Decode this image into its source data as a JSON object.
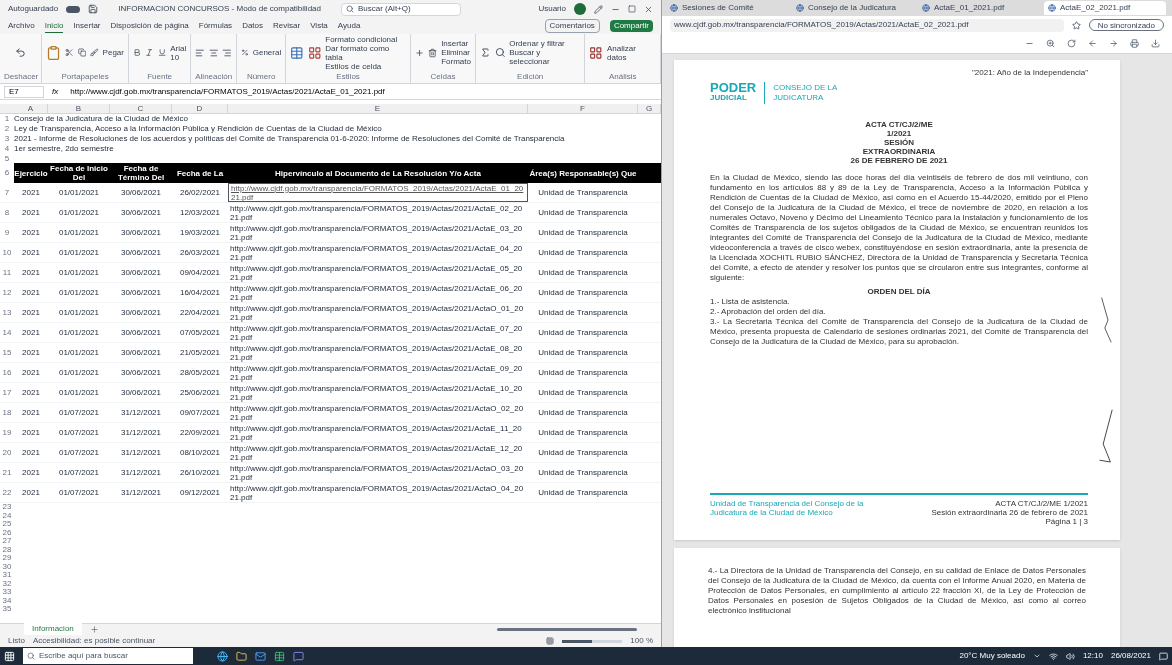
{
  "excel": {
    "autosave": "Autoguardado",
    "filename": "INFORMACION CONCURSOS - Modo de compatibilidad",
    "search": "Buscar (Alt+Q)",
    "user": "Usuario",
    "menu_tabs": [
      {
        "label": "Archivo",
        "selected": false
      },
      {
        "label": "Inicio",
        "selected": true
      },
      {
        "label": "Insertar",
        "selected": false
      },
      {
        "label": "Disposición de página",
        "selected": false
      },
      {
        "label": "Fórmulas",
        "selected": false
      },
      {
        "label": "Datos",
        "selected": false
      },
      {
        "label": "Revisar",
        "selected": false
      },
      {
        "label": "Vista",
        "selected": false
      },
      {
        "label": "Ayuda",
        "selected": false
      }
    ],
    "comments_button": "Comentarios",
    "share_button": "Compartir",
    "ribbon_groups": [
      {
        "label": "Deshacer"
      },
      {
        "label": "Portapapeles",
        "buttons": [
          "Pegar"
        ]
      },
      {
        "label": "Fuente",
        "buttons": [
          "Arial",
          "10"
        ]
      },
      {
        "label": "Alineación"
      },
      {
        "label": "Número",
        "buttons": [
          "General"
        ]
      },
      {
        "label": "Estilos",
        "buttons": [
          "Formato condicional",
          "Dar formato como tabla",
          "Estilos de celda"
        ]
      },
      {
        "label": "Celdas",
        "buttons": [
          "Insertar",
          "Eliminar",
          "Formato"
        ]
      },
      {
        "label": "Edición",
        "buttons": [
          "Ordenar y filtrar",
          "Buscar y seleccionar"
        ]
      },
      {
        "label": "Análisis",
        "buttons": [
          "Analizar datos"
        ]
      }
    ],
    "name_box": "E7",
    "formula_label": "fx",
    "formula": "http://www.cjdf.gob.mx/transparencia/FORMATOS_2019/Actas/2021/ActaE_01_2021.pdf",
    "columns": [
      "A",
      "B",
      "C",
      "D",
      "E",
      "F",
      "G"
    ],
    "top_row_numbers": [
      "1",
      "2",
      "3",
      "4",
      "5",
      "6"
    ],
    "intro_rows": [
      "Consejo de la Judicatura de la Ciudad de México",
      "Ley de Transparencia, Acceso a la Información Pública y Rendición de Cuentas de la Ciudad de México",
      "2021 - Informe de Resoluciones de los acuerdos y políticas del Comité de Transparencia 01-6-2020: Informe de Resoluciones del Comité de Transparencia",
      "1er semestre, 2do semestre"
    ],
    "header": [
      "Ejercicio",
      "Fecha de Inicio Del",
      "Fecha de Término Del",
      "Fecha de La",
      "Hipervínculo al Documento de La Resolución Y/o Acta",
      "Área(s) Responsable(s) Que"
    ],
    "rows": [
      {
        "num": "7",
        "selected": true,
        "cells": [
          "2021",
          "01/01/2021",
          "30/06/2021",
          "26/02/2021",
          "http://www.cjdf.gob.mx/transparencia/FORMATOS_2019/Actas/2021/ActaE_01_2021.pdf",
          "Unidad de Transparencia"
        ]
      },
      {
        "num": "8",
        "selected": false,
        "cells": [
          "2021",
          "01/01/2021",
          "30/06/2021",
          "12/03/2021",
          "http://www.cjdf.gob.mx/transparencia/FORMATOS_2019/Actas/2021/ActaE_02_2021.pdf",
          "Unidad de Transparencia"
        ]
      },
      {
        "num": "9",
        "selected": false,
        "cells": [
          "2021",
          "01/01/2021",
          "30/06/2021",
          "19/03/2021",
          "http://www.cjdf.gob.mx/transparencia/FORMATOS_2019/Actas/2021/ActaE_03_2021.pdf",
          "Unidad de Transparencia"
        ]
      },
      {
        "num": "10",
        "selected": false,
        "cells": [
          "2021",
          "01/01/2021",
          "30/06/2021",
          "26/03/2021",
          "http://www.cjdf.gob.mx/transparencia/FORMATOS_2019/Actas/2021/ActaE_04_2021.pdf",
          "Unidad de Transparencia"
        ]
      },
      {
        "num": "11",
        "selected": false,
        "cells": [
          "2021",
          "01/01/2021",
          "30/06/2021",
          "09/04/2021",
          "http://www.cjdf.gob.mx/transparencia/FORMATOS_2019/Actas/2021/ActaE_05_2021.pdf",
          "Unidad de Transparencia"
        ]
      },
      {
        "num": "12",
        "selected": false,
        "cells": [
          "2021",
          "01/01/2021",
          "30/06/2021",
          "16/04/2021",
          "http://www.cjdf.gob.mx/transparencia/FORMATOS_2019/Actas/2021/ActaE_06_2021.pdf",
          "Unidad de Transparencia"
        ]
      },
      {
        "num": "13",
        "selected": false,
        "cells": [
          "2021",
          "01/01/2021",
          "30/06/2021",
          "22/04/2021",
          "http://www.cjdf.gob.mx/transparencia/FORMATOS_2019/Actas/2021/ActaO_01_2021.pdf",
          "Unidad de Transparencia"
        ]
      },
      {
        "num": "14",
        "selected": false,
        "cells": [
          "2021",
          "01/01/2021",
          "30/06/2021",
          "07/05/2021",
          "http://www.cjdf.gob.mx/transparencia/FORMATOS_2019/Actas/2021/ActaE_07_2021.pdf",
          "Unidad de Transparencia"
        ]
      },
      {
        "num": "15",
        "selected": false,
        "cells": [
          "2021",
          "01/01/2021",
          "30/06/2021",
          "21/05/2021",
          "http://www.cjdf.gob.mx/transparencia/FORMATOS_2019/Actas/2021/ActaE_08_2021.pdf",
          "Unidad de Transparencia"
        ]
      },
      {
        "num": "16",
        "selected": false,
        "cells": [
          "2021",
          "01/01/2021",
          "30/06/2021",
          "28/05/2021",
          "http://www.cjdf.gob.mx/transparencia/FORMATOS_2019/Actas/2021/ActaE_09_2021.pdf",
          "Unidad de Transparencia"
        ]
      },
      {
        "num": "17",
        "selected": false,
        "cells": [
          "2021",
          "01/01/2021",
          "30/06/2021",
          "25/06/2021",
          "http://www.cjdf.gob.mx/transparencia/FORMATOS_2019/Actas/2021/ActaE_10_2021.pdf",
          "Unidad de Transparencia"
        ]
      },
      {
        "num": "18",
        "selected": false,
        "cells": [
          "2021",
          "01/07/2021",
          "31/12/2021",
          "09/07/2021",
          "http://www.cjdf.gob.mx/transparencia/FORMATOS_2019/Actas/2021/ActaO_02_2021.pdf",
          "Unidad de Transparencia"
        ]
      },
      {
        "num": "19",
        "selected": false,
        "cells": [
          "2021",
          "01/07/2021",
          "31/12/2021",
          "22/09/2021",
          "http://www.cjdf.gob.mx/transparencia/FORMATOS_2019/Actas/2021/ActaE_11_2021.pdf",
          "Unidad de Transparencia"
        ]
      },
      {
        "num": "20",
        "selected": false,
        "cells": [
          "2021",
          "01/07/2021",
          "31/12/2021",
          "08/10/2021",
          "http://www.cjdf.gob.mx/transparencia/FORMATOS_2019/Actas/2021/ActaE_12_2021.pdf",
          "Unidad de Transparencia"
        ]
      },
      {
        "num": "21",
        "selected": false,
        "cells": [
          "2021",
          "01/07/2021",
          "31/12/2021",
          "26/10/2021",
          "http://www.cjdf.gob.mx/transparencia/FORMATOS_2019/Actas/2021/ActaO_03_2021.pdf",
          "Unidad de Transparencia"
        ]
      },
      {
        "num": "22",
        "selected": false,
        "cells": [
          "2021",
          "01/07/2021",
          "31/12/2021",
          "09/12/2021",
          "http://www.cjdf.gob.mx/transparencia/FORMATOS_2019/Actas/2021/ActaO_04_2021.pdf",
          "Unidad de Transparencia"
        ]
      }
    ],
    "empty_row_numbers": [
      "23",
      "24",
      "25",
      "26",
      "27",
      "28",
      "29",
      "30",
      "31",
      "32",
      "33",
      "34",
      "35"
    ],
    "sheet_tabs": [
      {
        "label": "Informacion",
        "selected": true
      }
    ],
    "status": "Listo",
    "accessibility": "Accesibilidad: es posible continuar",
    "zoom": "100 %",
    "zoom_slider": {
      "level": 0.5
    }
  },
  "browser": {
    "tabs": [
      {
        "label": "Sesiones de Comité",
        "selected": false
      },
      {
        "label": "Consejo de la Judicatura",
        "selected": false
      },
      {
        "label": "ActaE_01_2021.pdf",
        "selected": false
      },
      {
        "label": "ActaE_02_2021.pdf",
        "selected": true
      }
    ],
    "address": "www.cjdf.gob.mx/transparencia/FORMATOS_2019/Actas/2021/ActaE_02_2021.pdf",
    "sync_button": "No sincronizado",
    "pdf": {
      "header_note": "\"2021: Año de la Independencia\"",
      "logo_left": [
        "PODER",
        "JUDICIAL"
      ],
      "logo_right": [
        "CONSEJO DE LA",
        "JUDICATURA"
      ],
      "title_lines": [
        "ACTA CT/CJ/2/ME",
        "1/2021",
        "SESIÓN",
        "EXTRAORDINARIA",
        "26 DE FEBRERO DE 2021"
      ],
      "paragraph": "En la Ciudad de México, siendo las doce horas del día veintiséis de febrero de dos mil veintiuno, con fundamento en los artículos 88 y 89 de la Ley de Transparencia, Acceso a la Información Pública y Rendición de Cuentas de la Ciudad de México, así como en el Acuerdo 15-44/2020, emitido por el Pleno del Consejo de la Judicatura de la Ciudad de México, el trece de noviembre de 2020, en relación a los numerales Octavo, Noveno y Décimo del Lineamiento Técnico para la Instalación y funcionamiento de los Comités de Transparencia de los sujetos obligados de la Ciudad de México, se encuentran reunidos los integrantes del Comité de Transparencia del Consejo de la Judicatura de la Ciudad de México, mediante videoconferencia a través de cisco webex, constituyéndose en sesión extraordinaria, ante la presencia de la Licenciada XOCHITL RUBIO SÁNCHEZ, Directora de la Unidad de Transparencia y Secretaria Técnica del Comité, a efecto de atender y resolver los puntos que se circularon entre sus integrantes, conforme al siguiente:",
      "agenda_title": "ORDEN DEL DÍA",
      "agenda_items": [
        "1.- Lista de asistencia.",
        "2.- Aprobación del orden del día.",
        "3.- La Secretaria Técnica del Comité de Transparencia del Consejo de la Judicatura de la Ciudad de México, presenta propuesta de Calendario de sesiones ordinarias 2021, del Comité de Transparencia del Consejo de la Judicatura de la Ciudad de México, para su aprobación."
      ],
      "footer_left": "Unidad de Transparencia del Consejo de la Judicatura de la Ciudad de México",
      "footer_right": [
        "ACTA CT/CJ/2/ME 1/2021",
        "Sesión extraordinaria 26 de febrero de 2021",
        "Página 1 | 3"
      ],
      "page2_paragraph": "4.- La Directora de la Unidad de Transparencia del Consejo, en su calidad de Enlace de Datos Personales del Consejo de la Judicatura de la Ciudad de México, da cuenta con el Informe Anual 2020, en Materia de Protección de Datos Personales, en cumplimiento al artículo 22 fracción XI, de la Ley de Protección de Datos Personales en posesión de Sujetos Obligados de la Ciudad de México, así como al correo electrónico institucional"
    }
  },
  "taskbar": {
    "search_placeholder": "Escribe aquí para buscar",
    "weather": "20°C Muy soleado",
    "time": "12:10",
    "date": "26/08/2021"
  }
}
